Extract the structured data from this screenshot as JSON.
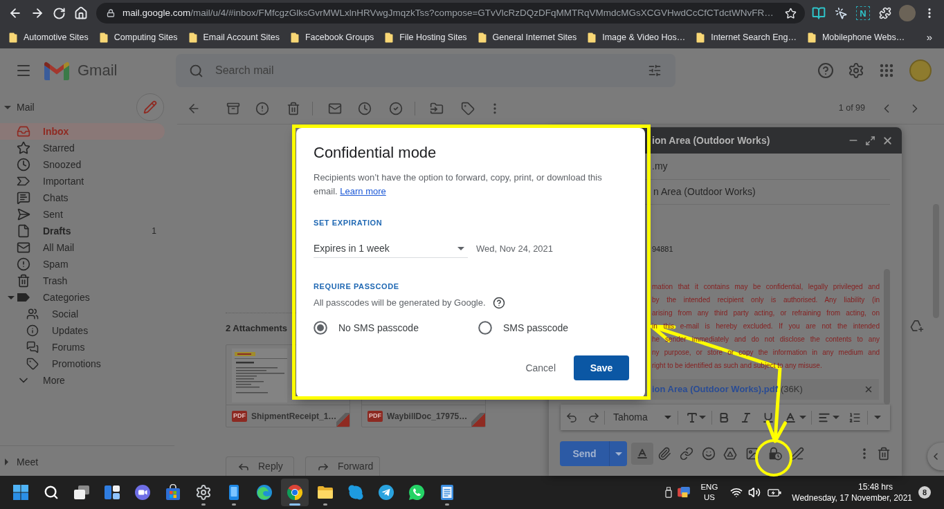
{
  "browser": {
    "url_host": "mail.google.com",
    "url_path": "/mail/u/4/#inbox/FMfcgzGlksGvrMWLxlnHRVwgJmqzkTss?compose=GTvVlcRzDQzDFqMMTRqVMmdcMGsXCGVHwdCcCfCTdctWNvFR…",
    "extension_badge": "N"
  },
  "bookmarks": {
    "items": [
      "Automotive Sites",
      "Computing Sites",
      "Email Account Sites",
      "Facebook Groups",
      "File Hosting Sites",
      "General Internet Sites",
      "Image & Video Hos…",
      "Internet Search Eng…",
      "Mobilephone Webs…"
    ],
    "overflow": "»"
  },
  "gmail": {
    "brand": "Gmail",
    "search": {
      "placeholder": "Search mail"
    },
    "sidebar": {
      "section": {
        "label": "Mail",
        "expanded": true
      },
      "items": [
        {
          "label": "Inbox",
          "selected": true
        },
        {
          "label": "Starred",
          "selected": false
        },
        {
          "label": "Snoozed",
          "selected": false
        },
        {
          "label": "Important",
          "selected": false
        },
        {
          "label": "Chats",
          "selected": false
        },
        {
          "label": "Sent",
          "selected": false
        },
        {
          "label": "Drafts",
          "selected": false,
          "count": "1"
        },
        {
          "label": "All Mail",
          "selected": false
        },
        {
          "label": "Spam",
          "selected": false
        },
        {
          "label": "Trash",
          "selected": false
        },
        {
          "label": "Categories",
          "selected": false,
          "expanded": true,
          "children": [
            {
              "label": "Social",
              "selected": false
            },
            {
              "label": "Updates",
              "selected": false
            },
            {
              "label": "Forums",
              "selected": false
            },
            {
              "label": "Promotions",
              "selected": false
            }
          ]
        },
        {
          "label": "More",
          "selected": false
        }
      ],
      "meet": {
        "label": "Meet",
        "expanded": false
      }
    },
    "toolbar": {
      "pager": "1 of 99"
    },
    "message": {
      "attachments_heading": "2 Attachments",
      "attachments": [
        {
          "name": "ShipmentReceipt_1…",
          "file_type": "PDF"
        },
        {
          "name": "WaybillDoc_17975…",
          "file_type": "PDF"
        }
      ],
      "actions": [
        "Reply",
        "Forward"
      ]
    },
    "compose": {
      "title": "ion Area (Outdoor Works)",
      "recipients": ".my",
      "subject": "n Area (Outdoor Works)",
      "body_fragment": "94881",
      "disclaimer_lines": [
        "mation that it contains may be confidential, legally privileged and",
        "by the intended recipient only is authorised. Any liability (in",
        "arising from any third party acting, or refraining from acting, on",
        "in this e-mail is hereby excluded. If you are not the intended",
        "he sender immediately and do not disclose the contents to any",
        "ny purpose, or store or copy the information in any medium and",
        "right to be identified as such and subject to any misuse."
      ],
      "attachment": {
        "name": "ion Area (Outdoor Works).pdf",
        "size": "(36K)"
      },
      "font": "Tahoma",
      "send": "Send"
    }
  },
  "dialog": {
    "title": "Confidential mode",
    "description": "Recipients won’t have the option to forward, copy, print, or download this email.",
    "learn_more": "Learn more",
    "expiration_heading": "SET EXPIRATION",
    "expiration": {
      "value": "Expires in 1 week"
    },
    "expiry_date": "Wed, Nov 24, 2021",
    "passcode_heading": "REQUIRE PASSCODE",
    "passcode_note": "All passcodes will be generated by Google.",
    "passcode_options": [
      {
        "label": "No SMS passcode",
        "selected": true
      },
      {
        "label": "SMS passcode",
        "selected": false
      }
    ],
    "cancel": "Cancel",
    "save": "Save"
  },
  "taskbar": {
    "apps": [
      {
        "running": false,
        "selected": false
      },
      {
        "running": false,
        "selected": false
      },
      {
        "running": false,
        "selected": false
      },
      {
        "running": false,
        "selected": false
      },
      {
        "running": false,
        "selected": false
      },
      {
        "running": false,
        "selected": false
      },
      {
        "running": true,
        "selected": false
      },
      {
        "running": true,
        "selected": false
      },
      {
        "running": false,
        "selected": false
      },
      {
        "running": true,
        "selected": true
      },
      {
        "running": true,
        "selected": false
      },
      {
        "running": false,
        "selected": false
      },
      {
        "running": false,
        "selected": false
      },
      {
        "running": false,
        "selected": false
      },
      {
        "running": true,
        "selected": false
      }
    ],
    "language": "ENG",
    "region": "US",
    "time": "15:48 hrs",
    "date": "Wednesday, 17 November, 2021",
    "notifications": "8"
  }
}
